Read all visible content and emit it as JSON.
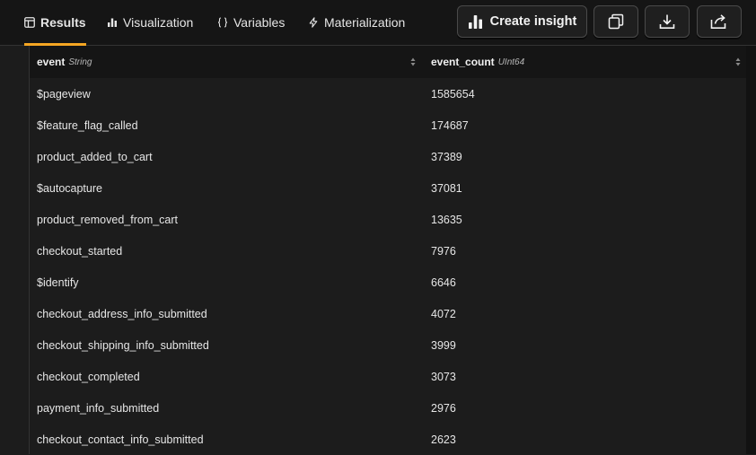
{
  "tabs": [
    {
      "label": "Results",
      "icon": "table-icon",
      "active": true
    },
    {
      "label": "Visualization",
      "icon": "bar-chart-icon",
      "active": false
    },
    {
      "label": "Variables",
      "icon": "braces-icon",
      "active": false
    },
    {
      "label": "Materialization",
      "icon": "bolt-icon",
      "active": false
    }
  ],
  "toolbar": {
    "create_insight_label": "Create insight",
    "create_insight_icon": "bar-chart-icon",
    "copy_icon": "copy-icon",
    "download_icon": "download-icon",
    "share_icon": "share-icon"
  },
  "accent_color": "#f5a623",
  "table": {
    "columns": [
      {
        "name": "event",
        "type": "String"
      },
      {
        "name": "event_count",
        "type": "UInt64"
      }
    ],
    "rows": [
      [
        "$pageview",
        "1585654"
      ],
      [
        "$feature_flag_called",
        "174687"
      ],
      [
        "product_added_to_cart",
        "37389"
      ],
      [
        "$autocapture",
        "37081"
      ],
      [
        "product_removed_from_cart",
        "13635"
      ],
      [
        "checkout_started",
        "7976"
      ],
      [
        "$identify",
        "6646"
      ],
      [
        "checkout_address_info_submitted",
        "4072"
      ],
      [
        "checkout_shipping_info_submitted",
        "3999"
      ],
      [
        "checkout_completed",
        "3073"
      ],
      [
        "payment_info_submitted",
        "2976"
      ],
      [
        "checkout_contact_info_submitted",
        "2623"
      ]
    ]
  }
}
